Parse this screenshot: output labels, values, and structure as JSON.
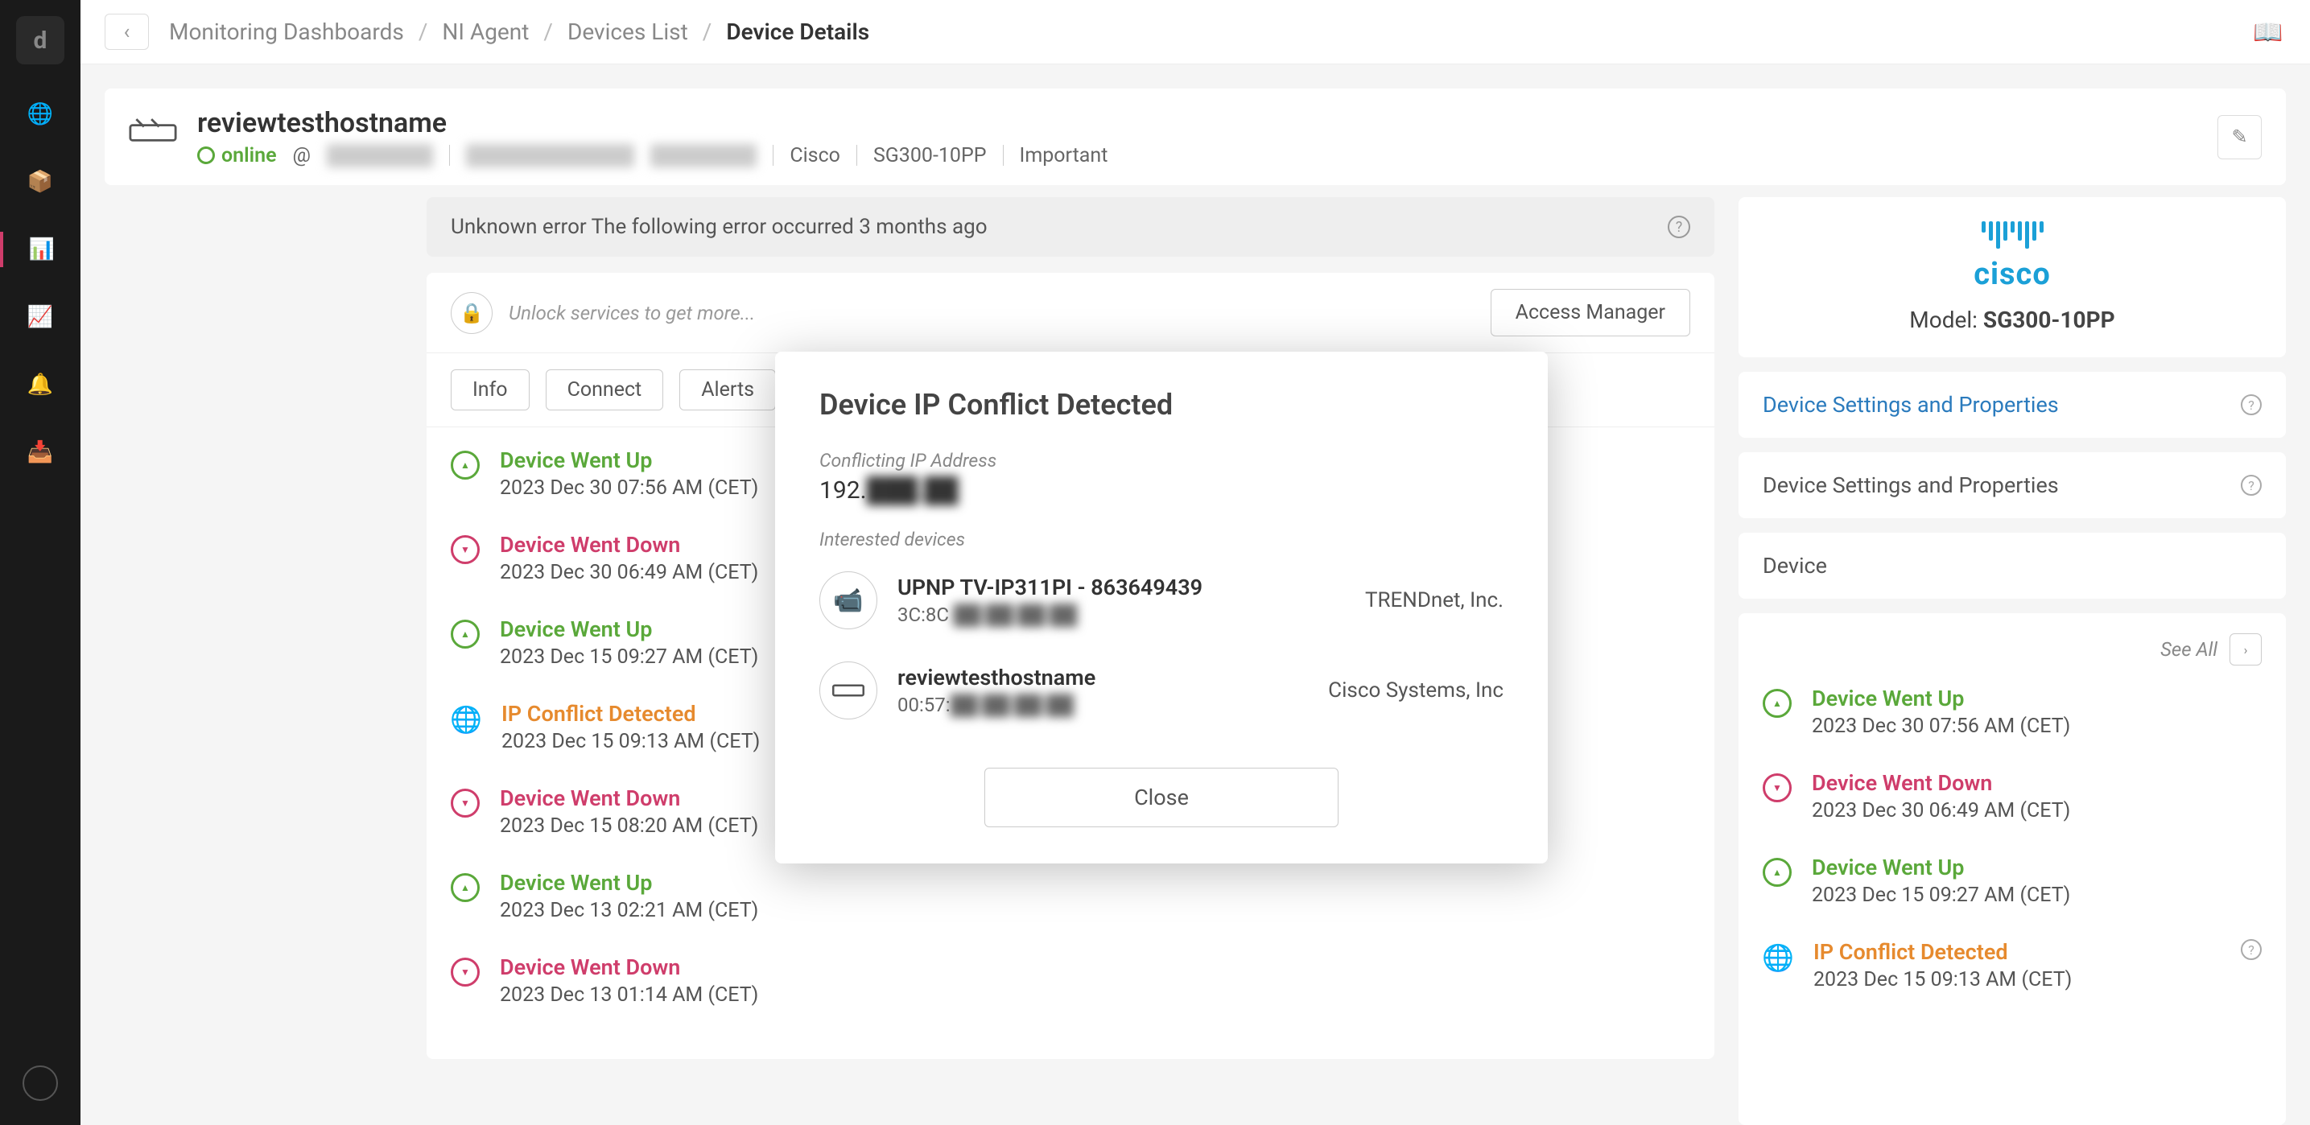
{
  "breadcrumbs": [
    "Monitoring Dashboards",
    "NI Agent",
    "Devices List",
    "Device Details"
  ],
  "header": {
    "hostname": "reviewtesthostname",
    "status": "online",
    "at": "@",
    "ip_masked": "███████",
    "mac_masked": "██:██:██:██:██",
    "range_masked": "███████",
    "vendor": "Cisco",
    "model": "SG300-10PP",
    "importance": "Important"
  },
  "error_banner": "Unknown error The following error occurred 3 months ago",
  "unlock": {
    "text": "Unlock services to get more...",
    "button": "Access Manager"
  },
  "tabs": [
    "Info",
    "Connect",
    "Alerts"
  ],
  "timeline": [
    {
      "kind": "up",
      "title": "Device Went Up",
      "date": "2023 Dec 30 07:56 AM (CET)"
    },
    {
      "kind": "down",
      "title": "Device Went Down",
      "date": "2023 Dec 30 06:49 AM (CET)"
    },
    {
      "kind": "up",
      "title": "Device Went Up",
      "date": "2023 Dec 15 09:27 AM (CET)"
    },
    {
      "kind": "conflict",
      "title": "IP Conflict Detected",
      "date": "2023 Dec 15 09:13 AM (CET)"
    },
    {
      "kind": "down",
      "title": "Device Went Down",
      "date": "2023 Dec 15 08:20 AM (CET)"
    },
    {
      "kind": "up",
      "title": "Device Went Up",
      "date": "2023 Dec 13 02:21 AM (CET)"
    },
    {
      "kind": "down",
      "title": "Device Went Down",
      "date": "2023 Dec 13 01:14 AM (CET)"
    }
  ],
  "right": {
    "cisco": "cisco",
    "model_label": "Model:",
    "model_value": "SG300-10PP",
    "link1": "Device Settings and Properties",
    "link2": "Device Settings and Properties",
    "link3": "Device",
    "see_all": "See All"
  },
  "side_timeline": [
    {
      "kind": "up",
      "title": "Device Went Up",
      "date": "2023 Dec 30 07:56 AM (CET)"
    },
    {
      "kind": "down",
      "title": "Device Went Down",
      "date": "2023 Dec 30 06:49 AM (CET)"
    },
    {
      "kind": "up",
      "title": "Device Went Up",
      "date": "2023 Dec 15 09:27 AM (CET)"
    },
    {
      "kind": "conflict",
      "title": "IP Conflict Detected",
      "date": "2023 Dec 15 09:13 AM (CET)"
    }
  ],
  "modal": {
    "title": "Device IP Conflict Detected",
    "ip_label": "Conflicting IP Address",
    "ip_prefix": "192.",
    "ip_masked": "███.██",
    "devices_label": "Interested devices",
    "devices": [
      {
        "name": "UPNP TV-IP311PI - 863649439",
        "mac_prefix": "3C:8C",
        "mac_masked": ":██:██:██:██",
        "vendor": "TRENDnet, Inc."
      },
      {
        "name": "reviewtesthostname",
        "mac_prefix": "00:57:",
        "mac_masked": "██:██:██:██",
        "vendor": "Cisco Systems, Inc"
      }
    ],
    "close": "Close"
  }
}
